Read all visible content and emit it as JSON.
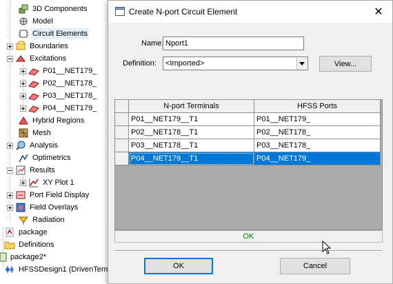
{
  "tree": {
    "items": [
      {
        "label": "3D Components"
      },
      {
        "label": "Model"
      },
      {
        "label": "Circuit Elements"
      },
      {
        "label": "Boundaries"
      },
      {
        "label": "Excitations"
      },
      {
        "label": "P01__NET179_"
      },
      {
        "label": "P02__NET178_"
      },
      {
        "label": "P03__NET178_"
      },
      {
        "label": "P04__NET179_"
      },
      {
        "label": "Hybrid Regions"
      },
      {
        "label": "Mesh"
      },
      {
        "label": "Analysis"
      },
      {
        "label": "Optimetrics"
      },
      {
        "label": "Results"
      },
      {
        "label": "XY Plot 1"
      },
      {
        "label": "Port Field Display"
      },
      {
        "label": "Field Overlays"
      },
      {
        "label": "Radiation"
      },
      {
        "label": "package"
      },
      {
        "label": "Definitions"
      },
      {
        "label": "package2*"
      },
      {
        "label": "HFSSDesign1 (DrivenTermi"
      }
    ]
  },
  "dialog": {
    "title": "Create N-port Circuit Element",
    "close_glyph": "✕",
    "name_label": "Name:",
    "name_value": "Nport1",
    "definition_label": "Definition:",
    "definition_value": "<Imported>",
    "view_button": "View...",
    "grid": {
      "headers": [
        "N-port Terminals",
        "HFSS Ports"
      ],
      "rows": [
        {
          "terminal": "P01__NET179__T1",
          "port": "P01__NET179_"
        },
        {
          "terminal": "P02__NET178__T1",
          "port": "P02__NET178_"
        },
        {
          "terminal": "P03__NET178__T1",
          "port": "P03__NET178_"
        },
        {
          "terminal": "P04__NET179__T1",
          "port": "P04__NET179_"
        }
      ],
      "selected_row": 4
    },
    "status_text": "OK",
    "ok_button": "OK",
    "cancel_button": "Cancel"
  },
  "colors": {
    "selection": "#0078d7",
    "status_ok": "#008000",
    "dialog_bg": "#f0f0f0"
  }
}
